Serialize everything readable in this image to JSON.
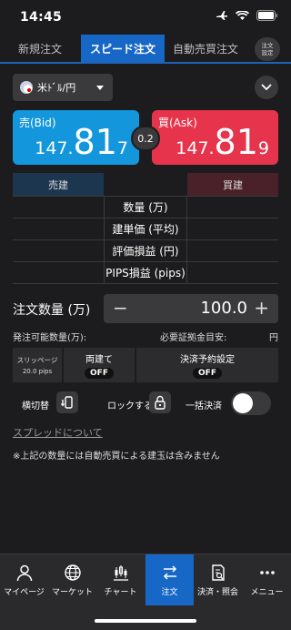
{
  "status": {
    "time": "14:45"
  },
  "tabs": [
    {
      "label": "新規注文"
    },
    {
      "label": "スピード注文"
    },
    {
      "label": "自動売買注文"
    }
  ],
  "order_settings_button": "注文\n設定",
  "pair": {
    "label": "米ﾄﾞﾙ/円"
  },
  "prices": {
    "bid_label": "売(Bid)",
    "bid_small": "147.",
    "bid_big": "81",
    "bid_tail": "7",
    "ask_label": "買(Ask)",
    "ask_small": "147.",
    "ask_big": "81",
    "ask_tail": "9",
    "spread": "0.2"
  },
  "positions": {
    "sell_header": "売建",
    "buy_header": "買建",
    "rows": [
      "数量 (万)",
      "建単価 (平均)",
      "評価損益 (円)",
      "PIPS損益 (pips)"
    ]
  },
  "order_qty": {
    "label": "注文数量 (万)",
    "value": "100.0",
    "minus": "−",
    "plus": "+"
  },
  "margin": {
    "available_label": "発注可能数量(万):",
    "required_label": "必要証拠金目安:",
    "required_unit": "円"
  },
  "settings": {
    "slippage_label": "スリッページ",
    "slippage_value": "20.0 pips",
    "hedge_label": "両建て",
    "hedge_value": "OFF",
    "settle_label": "決済予約設定",
    "settle_value": "OFF"
  },
  "toggles": {
    "rotate_label": "横切替",
    "lock_label": "ロックする",
    "bulk_label": "一括決済"
  },
  "spread_link": "スプレッドについて",
  "note": "※上記の数量には自動売買による建玉は含みません",
  "nav": [
    {
      "label": "マイページ"
    },
    {
      "label": "マーケット"
    },
    {
      "label": "チャート"
    },
    {
      "label": "注文"
    },
    {
      "label": "決済・照会"
    },
    {
      "label": "メニュー"
    }
  ],
  "colors": {
    "bid": "#1496dc",
    "ask": "#e5344b",
    "accent": "#1767c6"
  }
}
